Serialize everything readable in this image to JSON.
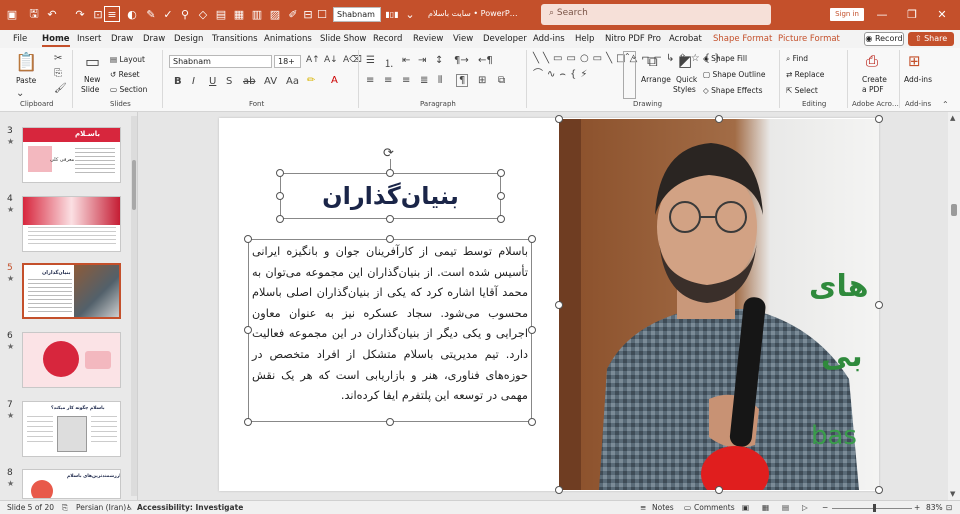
{
  "title_bar": {
    "font_name": "Shabnam",
    "doc_title": "سایت باسلام  •  PowerP…",
    "search_placeholder": "Search",
    "sign_in": "Sign in"
  },
  "menu": {
    "items": [
      "File",
      "Home",
      "Insert",
      "Draw",
      "Draw",
      "Design",
      "Transitions",
      "Animations",
      "Slide Show",
      "Record",
      "Review",
      "View",
      "Developer",
      "Add-ins",
      "Help",
      "Nitro PDF Pro",
      "Acrobat",
      "Shape Format",
      "Picture Format"
    ],
    "active": "Home",
    "record": "Record",
    "share": "Share"
  },
  "ribbon": {
    "clipboard": {
      "paste": "Paste",
      "label": "Clipboard"
    },
    "slides": {
      "new_slide_1": "New",
      "new_slide_2": "Slide",
      "layout": "Layout",
      "reset": "Reset",
      "section": "Section",
      "label": "Slides"
    },
    "font": {
      "font_name": "Shabnam",
      "font_size": "18+",
      "label": "Font"
    },
    "paragraph": {
      "label": "Paragraph"
    },
    "drawing": {
      "arrange": "Arrange",
      "quick_styles_1": "Quick",
      "quick_styles_2": "Styles",
      "shape_fill": "Shape Fill",
      "shape_outline": "Shape Outline",
      "shape_effects": "Shape Effects",
      "label": "Drawing"
    },
    "editing": {
      "find": "Find",
      "replace": "Replace",
      "select": "Select",
      "label": "Editing"
    },
    "adobe": {
      "create_pdf_1": "Create",
      "create_pdf_2": "a PDF",
      "label": "Adobe Acro…"
    },
    "addins": {
      "addins": "Add-ins",
      "label": "Add-ins"
    }
  },
  "thumbnails": [
    {
      "num": "3",
      "star": "★",
      "title": "باسـلام",
      "sub": "معرفی کلی"
    },
    {
      "num": "4",
      "star": "★",
      "title": "",
      "sub": ""
    },
    {
      "num": "5",
      "star": "★",
      "title": "بنیان‌گذاران",
      "sub": "",
      "selected": true
    },
    {
      "num": "6",
      "star": "★",
      "title": "",
      "sub": ""
    },
    {
      "num": "7",
      "star": "★",
      "title": "باسلام چگونه کار میکند؟",
      "sub": ""
    },
    {
      "num": "8",
      "star": "★",
      "title": "ارزشمندترین‌های باسلام",
      "sub": ""
    }
  ],
  "slide": {
    "title": "بنیان‌گذاران",
    "body": "باسلام توسط تیمی از کارآفرینان جوان و بانگیزه ایرانی تأسیس شده است. از بنیان‌گذاران این مجموعه می‌توان به محمد آقایا اشاره کرد که یکی از بنیان‌گذاران اصلی باسلام محسوب می‌شود. سجاد عسکره نیز به عنوان معاون اجرایی و یکی دیگر از بنیان‌گذاران در این مجموعه فعالیت دارد. تیم مدیریتی باسلام متشکل از افراد متخصص در حوزه‌های فناوری، هنر و بازاریابی است که هر یک نقش مهمی در توسعه این پلتفرم ایفا کرده‌اند.",
    "photo_text_1": "های",
    "photo_text_2": "بی",
    "photo_text_3": "bas"
  },
  "status": {
    "slide_of": "Slide 5 of 20",
    "language": "Persian (Iran)",
    "accessibility": "Accessibility: Investigate",
    "notes": "Notes",
    "comments": "Comments",
    "zoom": "83%"
  },
  "colors": {
    "accent": "#c4502b",
    "title": "#1a2548",
    "thumb_red": "#d7263d"
  }
}
